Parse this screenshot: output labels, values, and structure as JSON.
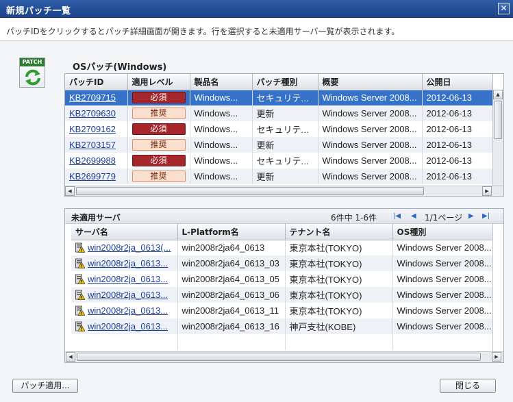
{
  "window": {
    "title": "新規パッチ一覧",
    "close_glyph": "✕"
  },
  "description": "パッチIDをクリックするとパッチ詳細画面が開きます。行を選択すると未適用サーバ一覧が表示されます。",
  "icon": {
    "label": "PATCH",
    "name": "patch-refresh-icon"
  },
  "patches": {
    "title": "OSパッチ(Windows)",
    "columns": [
      "パッチID",
      "適用レベル",
      "製品名",
      "パッチ種別",
      "概要",
      "公開日"
    ],
    "rows": [
      {
        "id": "KB2709715",
        "level": "必須",
        "level_type": "required",
        "product": "Windows...",
        "type": "セキュリティ...",
        "summary": "Windows Server 2008...",
        "date": "2012-06-13",
        "selected": true
      },
      {
        "id": "KB2709630",
        "level": "推奨",
        "level_type": "recommended",
        "product": "Windows...",
        "type": "更新",
        "summary": "Windows Server 2008...",
        "date": "2012-06-13"
      },
      {
        "id": "KB2709162",
        "level": "必須",
        "level_type": "required",
        "product": "Windows...",
        "type": "セキュリティ...",
        "summary": "Windows Server 2008...",
        "date": "2012-06-13"
      },
      {
        "id": "KB2703157",
        "level": "推奨",
        "level_type": "recommended",
        "product": "Windows...",
        "type": "更新",
        "summary": "Windows Server 2008...",
        "date": "2012-06-13"
      },
      {
        "id": "KB2699988",
        "level": "必須",
        "level_type": "required",
        "product": "Windows...",
        "type": "セキュリティ...",
        "summary": "Windows Server 2008...",
        "date": "2012-06-13"
      },
      {
        "id": "KB2699779",
        "level": "推奨",
        "level_type": "recommended",
        "product": "Windows...",
        "type": "更新",
        "summary": "Windows Server 2008...",
        "date": "2012-06-13"
      }
    ]
  },
  "servers": {
    "title": "未適用サーバ",
    "count_text": "6件中 1-6件",
    "page_text": "1/1ページ",
    "columns": [
      "サーバ名",
      "L-Platform名",
      "テナント名",
      "OS種別"
    ],
    "rows": [
      {
        "name": "win2008r2ja_0613(...",
        "lplatform": "win2008r2ja64_0613",
        "tenant": "東京本社(TOKYO)",
        "os": "Windows Server 2008..."
      },
      {
        "name": "win2008r2ja_0613...",
        "lplatform": "win2008r2ja64_0613_03",
        "tenant": "東京本社(TOKYO)",
        "os": "Windows Server 2008..."
      },
      {
        "name": "win2008r2ja_0613...",
        "lplatform": "win2008r2ja64_0613_05",
        "tenant": "東京本社(TOKYO)",
        "os": "Windows Server 2008..."
      },
      {
        "name": "win2008r2ja_0613...",
        "lplatform": "win2008r2ja64_0613_06",
        "tenant": "東京本社(TOKYO)",
        "os": "Windows Server 2008..."
      },
      {
        "name": "win2008r2ja_0613...",
        "lplatform": "win2008r2ja64_0613_11",
        "tenant": "東京本社(TOKYO)",
        "os": "Windows Server 2008..."
      },
      {
        "name": "win2008r2ja_0613...",
        "lplatform": "win2008r2ja64_0613_16",
        "tenant": "神戸支社(KOBE)",
        "os": "Windows Server 2008..."
      }
    ]
  },
  "buttons": {
    "apply": "パッチ適用...",
    "close": "閉じる"
  },
  "colors": {
    "title_bar": "#1b4388",
    "selected_row": "#3672c8",
    "required": "#a5262b",
    "recommended": "#fbe0cf",
    "link": "#1f3f9c"
  }
}
